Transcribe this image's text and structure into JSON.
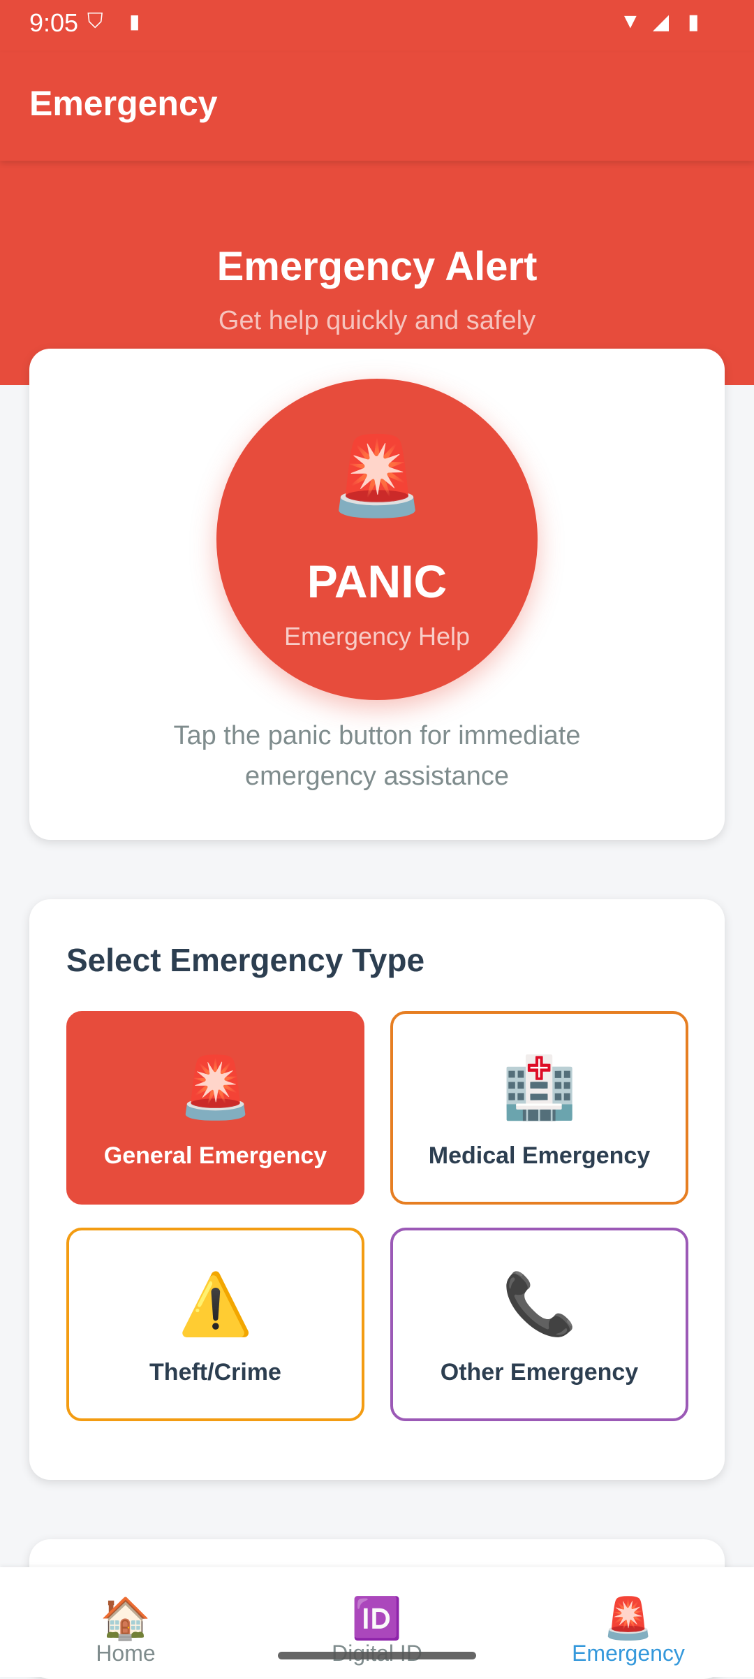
{
  "status_bar": {
    "time": "9:05",
    "icons": [
      "shield-icon",
      "sd-card-icon",
      "wifi-icon",
      "signal-icon",
      "battery-icon"
    ]
  },
  "app_bar": {
    "title": "Emergency"
  },
  "hero": {
    "title": "Emergency Alert",
    "subtitle": "Get help quickly and safely"
  },
  "panic": {
    "icon": "🚨",
    "label": "PANIC",
    "sublabel": "Emergency Help",
    "hint": "Tap the panic button for immediate emergency assistance"
  },
  "emergency_types": {
    "title": "Select Emergency Type",
    "items": [
      {
        "icon": "🚨",
        "label": "General Emergency",
        "color": "#e74c3c",
        "selected": true
      },
      {
        "icon": "🏥",
        "label": "Medical Emergency",
        "color": "#e67e22",
        "selected": false
      },
      {
        "icon": "⚠️",
        "label": "Theft/Crime",
        "color": "#f39c12",
        "selected": false
      },
      {
        "icon": "📞",
        "label": "Other Emergency",
        "color": "#9b59b6",
        "selected": false
      }
    ]
  },
  "bottom_nav": {
    "items": [
      {
        "icon": "🏠",
        "label": "Home",
        "active": false
      },
      {
        "icon": "🆔",
        "label": "Digital ID",
        "active": false
      },
      {
        "icon": "🚨",
        "label": "Emergency",
        "active": true
      }
    ]
  },
  "colors": {
    "primary": "#e74c3c",
    "active_tab": "#3498db"
  }
}
